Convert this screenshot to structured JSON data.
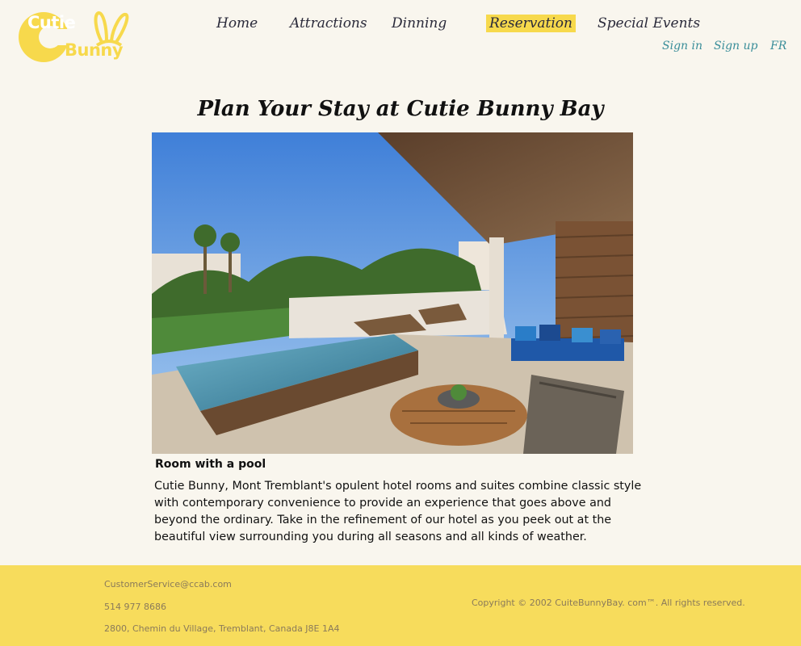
{
  "brand": {
    "logo_top": "Cutie",
    "logo_bottom": "Bunny",
    "colors": {
      "yellow": "#f7d94c",
      "teal": "#3b8e9a",
      "background": "#f9f6ee"
    }
  },
  "nav": {
    "items": [
      {
        "label": "Home"
      },
      {
        "label": "Attractions"
      },
      {
        "label": "Dinning"
      },
      {
        "label": "Reservation",
        "active": true
      },
      {
        "label": "Special Events"
      }
    ]
  },
  "auth": {
    "sign_in": "Sign in",
    "sign_up": "Sign up",
    "lang": "FR"
  },
  "main": {
    "title": "Plan Your Stay at Cutie Bunny Bay",
    "room_title": "Room with a pool",
    "room_description": "Cutie Bunny, Mont Tremblant's opulent hotel rooms and suites combine classic style with contemporary convenience to provide an experience that goes above and beyond the ordinary. Take in the refinement of our hotel as you peek out at the beautiful view surrounding you during all seasons and all kinds of weather."
  },
  "footer": {
    "email": "CustomerService@ccab.com",
    "phone": "514 977 8686",
    "address": "2800, Chemin du Village, Tremblant, Canada J8E 1A4",
    "copyright": "Copyright © 2002 CuiteBunnyBay. com™. All rights reserved."
  }
}
